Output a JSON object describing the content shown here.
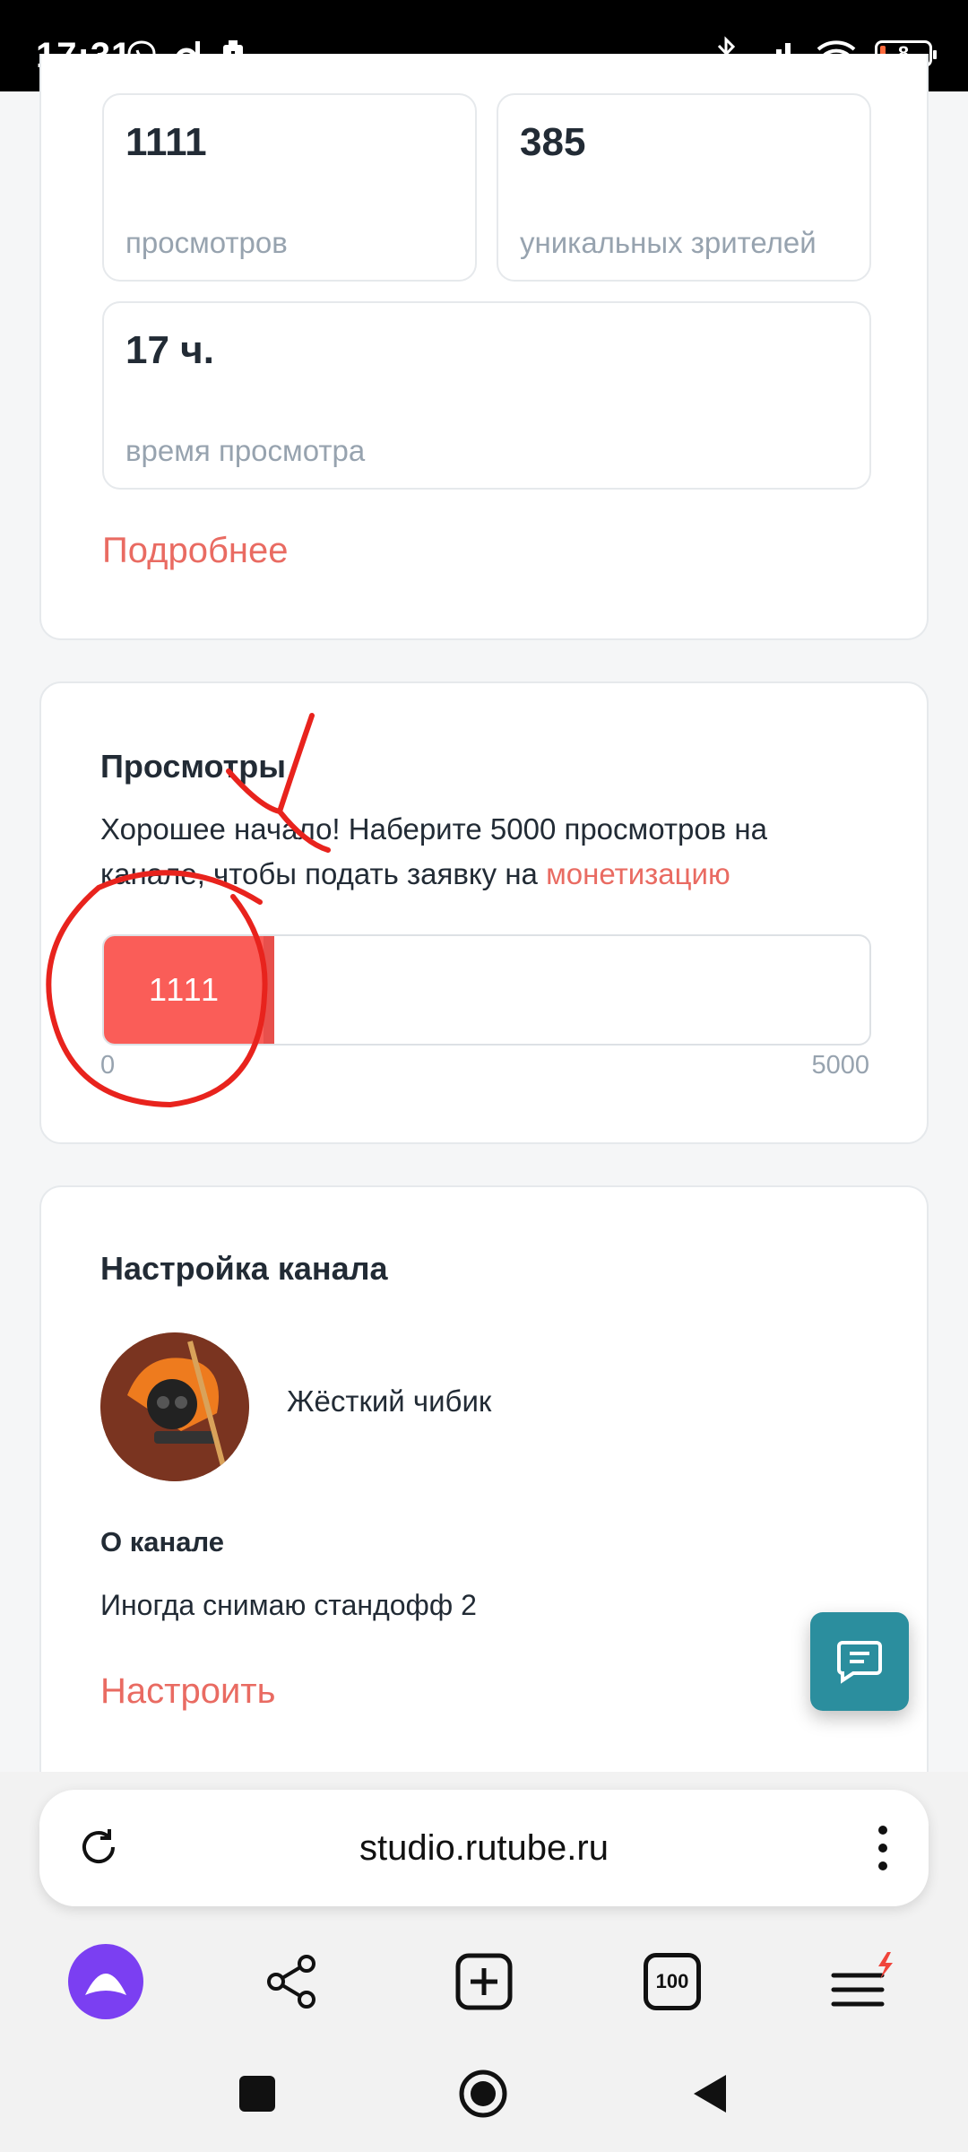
{
  "status_bar": {
    "time": "17:31",
    "battery": "8"
  },
  "stats": [
    {
      "value": "1111",
      "label": "просмотров"
    },
    {
      "value": "385",
      "label": "уникальных зрителей"
    },
    {
      "value": "17 ч.",
      "label": "время просмотра"
    }
  ],
  "more_link": "Подробнее",
  "views_card": {
    "title": "Просмотры",
    "text": "Хорошее начало! Наберите 5000 просмотров на канале, чтобы подать заявку на ",
    "link": "монетизацию",
    "progress": {
      "current": 1111,
      "current_label": "1111",
      "min_label": "0",
      "max_label": "5000",
      "max": 5000
    }
  },
  "channel_card": {
    "title": "Настройка канала",
    "channel_name": "Жёсткий чибик",
    "about_title": "О канале",
    "about_text": "Иногда снимаю стандофф 2",
    "configure_link": "Настроить"
  },
  "browser": {
    "url": "studio.rutube.ru",
    "tabs_count": "100"
  },
  "colors": {
    "accent": "#e96b62",
    "progress": "#fa5d58",
    "fab": "#2b8e9e",
    "alice": "#7b3ff2",
    "annotation": "#e8231d"
  }
}
